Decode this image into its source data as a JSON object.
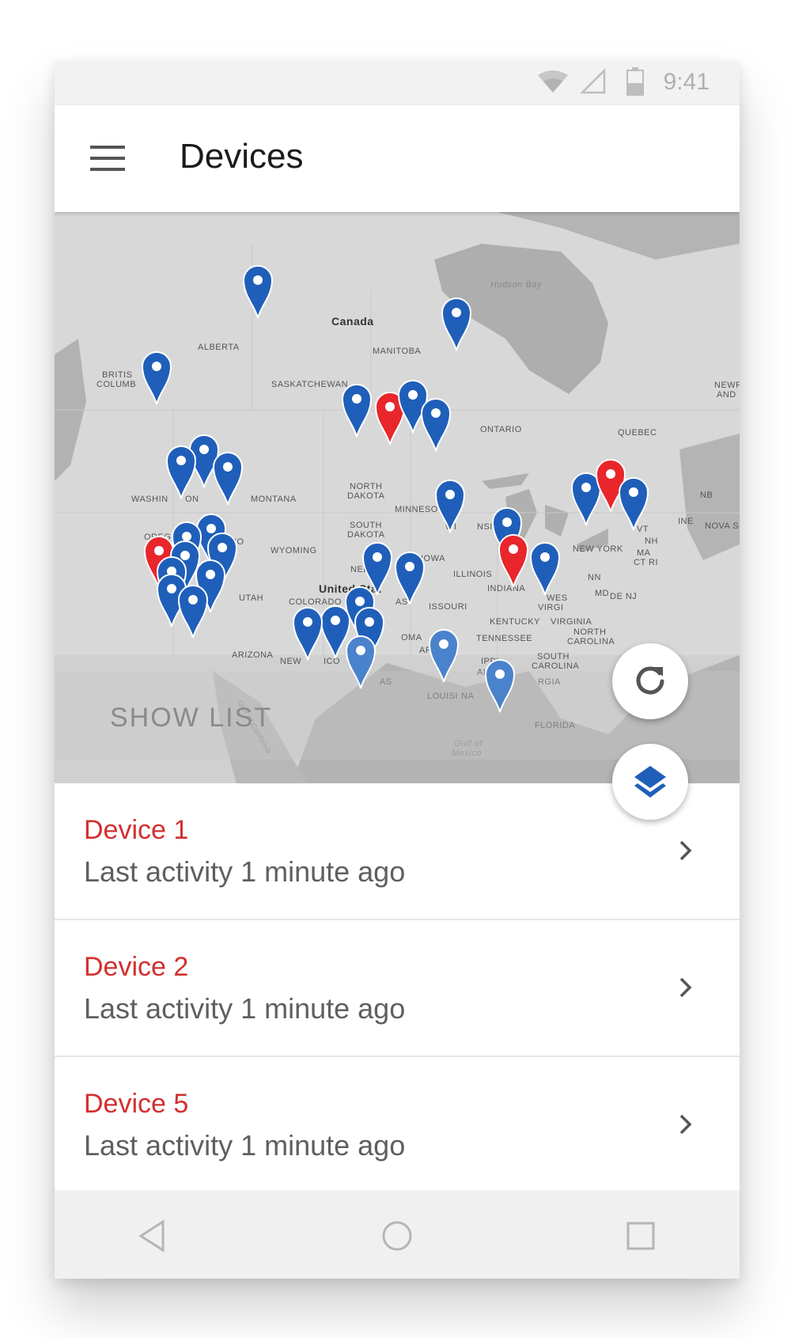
{
  "status_bar": {
    "time": "9:41",
    "icons": [
      "wifi-icon",
      "cellular-signal-icon",
      "battery-icon"
    ]
  },
  "app_bar": {
    "title": "Devices",
    "menu_icon": "hamburger-menu-icon"
  },
  "map": {
    "labels": {
      "hudson_bay": "Hudson Bay",
      "canada": "Canada",
      "alberta": "ALBERTA",
      "manitoba": "MANITOBA",
      "british_columbia_1": "BRITIS",
      "british_columbia_2": "COLUMB",
      "saskatchewan": "SASKATCHEWAN",
      "ontario": "ONTARIO",
      "quebec": "QUEBEC",
      "newfoundland_1": "NEWF",
      "newfoundland_2": "AND",
      "washington": "WASHIN",
      "washington_2": "ON",
      "montana": "MONTANA",
      "north_dakota_1": "NORTH",
      "north_dakota_2": "DAKOTA",
      "minnesota": "MINNESOTA",
      "nb": "NB",
      "oregon": "OREGO",
      "idaho": "HO",
      "wyoming": "WYOMING",
      "south_dakota_1": "SOUTH",
      "south_dakota_2": "DAKOTA",
      "wisconsin": "WI",
      "wisconsin_2": "NSIN",
      "michigan": "MI",
      "maine": "INE",
      "nova_scotia": "NOVA SC",
      "vt": "VT",
      "nh": "NH",
      "new_york": "NEW YORK",
      "ma": "MA",
      "ct_ri": "CT RI",
      "iowa": "IOWA",
      "nebraska": "NEBI",
      "united_states": "United Stat",
      "illinois": "ILLINOIS",
      "indiana": "INDIANA",
      "utah": "UTAH",
      "colorado": "COLORADO",
      "kansas": "AS",
      "missouri": "ISSOURI",
      "west_virginia_1": "WES",
      "west_virginia_2": "VIRGI",
      "md": "MD",
      "de_nj": "DE NJ",
      "pa": "NN",
      "kentucky": "KENTUCKY",
      "virginia": "VIRGINIA",
      "tennessee": "TENNESSEE",
      "north_carolina_1": "NORTH",
      "north_carolina_2": "CAROLINA",
      "arizona": "ARIZONA",
      "new_mexico": "NEW",
      "new_mexico_2": "ICO",
      "oklahoma": "OMA",
      "arkansas": "ARKA",
      "mississippi": "IPPI",
      "alabama": "ALABA",
      "south_carolina_1": "SOUTH",
      "south_carolina_2": "CAROLINA",
      "georgia": "RGIA",
      "texas": "AS",
      "louisiana": "LOUISI",
      "louisiana_2": "NA",
      "florida": "FLORIDA",
      "gulf_1": "Gulf of",
      "gulf_2": "Mexico",
      "gulf_california": "Gulf of California"
    },
    "pin_colors": {
      "normal": "#1f5fba",
      "alert": "#e8262b",
      "faded": "#4a82cc"
    }
  },
  "show_list": {
    "label": "SHOW LIST"
  },
  "fab": {
    "refresh_icon": "refresh-icon",
    "layers_icon": "layers-icon"
  },
  "devices": [
    {
      "name": "Device 1",
      "activity": "Last activity 1 minute ago"
    },
    {
      "name": "Device 2",
      "activity": "Last activity 1 minute ago"
    },
    {
      "name": "Device 5",
      "activity": "Last activity 1 minute ago"
    }
  ],
  "nav_bar": {
    "icons": [
      "back-icon",
      "home-icon",
      "recents-icon"
    ]
  }
}
